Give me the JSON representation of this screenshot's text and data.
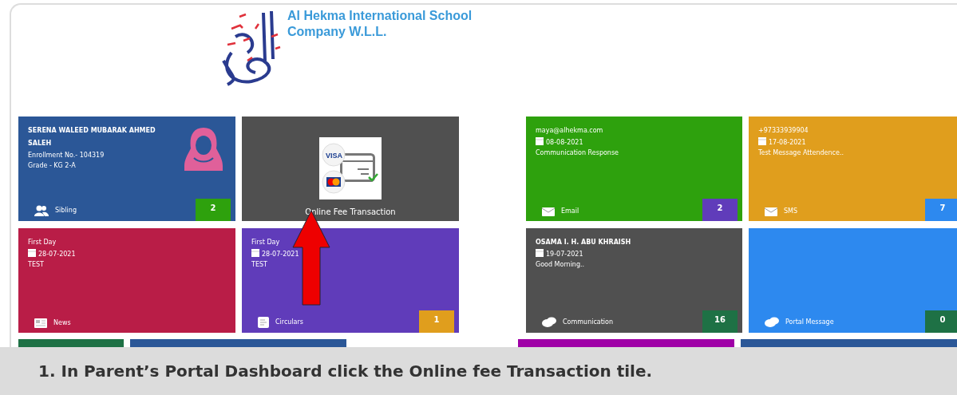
{
  "header": {
    "school_name": "Al Hekma International School",
    "company": "Company W.L.L."
  },
  "tiles": [
    {
      "kind": "student",
      "color": "#2b5797",
      "name": "SERENA WALEED MUBARAK AHMED SALEH",
      "enrollment": "Enrollment No.- 104319",
      "grade": "Grade - KG 2-A",
      "footer": {
        "kind": "people",
        "label": "Sibling"
      },
      "badge": {
        "text": "2",
        "color": "#2ea10d"
      }
    },
    {
      "kind": "feature",
      "color": "#505050",
      "card_brand": "VISA",
      "label": "Online Fee Transaction"
    },
    {
      "kind": "spacer"
    },
    {
      "kind": "message",
      "color": "#2ea10d",
      "title": "maya@alhekma.com",
      "date": "08-08-2021",
      "body": "Communication Response",
      "footer": {
        "kind": "envelope",
        "label": "Email"
      },
      "badge": {
        "text": "2",
        "color": "#603cba"
      }
    },
    {
      "kind": "message",
      "color": "#e09e1d",
      "title": "+97333939904",
      "date": "17-08-2021",
      "body": "Test Message Attendence..",
      "footer": {
        "kind": "envelope",
        "label": "SMS"
      },
      "badge": {
        "text": "7",
        "color": "#2d89ef"
      }
    },
    {
      "kind": "message",
      "color": "#b91d47",
      "title": "First Day",
      "date": "28-07-2021",
      "body": "TEST",
      "footer": {
        "kind": "newspaper",
        "label": "News"
      }
    },
    {
      "kind": "message",
      "color": "#603cba",
      "title": "First Day",
      "date": "28-07-2021",
      "body": "TEST",
      "footer": {
        "kind": "document",
        "label": "Circulars"
      },
      "badge": {
        "text": "1",
        "color": "#e09e1d"
      }
    },
    {
      "kind": "spacer"
    },
    {
      "kind": "message",
      "color": "#505050",
      "title": "OSAMA I. H. ABU KHRAISH",
      "date": "19-07-2021",
      "body": "Good Morning..",
      "footer": {
        "kind": "chat",
        "label": "Communication"
      },
      "badge": {
        "text": "16",
        "color": "#1e7145"
      }
    },
    {
      "kind": "message",
      "color": "#2d89ef",
      "footer": {
        "kind": "chat",
        "label": "Portal Message"
      },
      "badge": {
        "text": "0",
        "color": "#1e7145"
      }
    }
  ],
  "partial_tiles": [
    {
      "color": "#1e7145",
      "kind": "half"
    },
    {
      "color": "#2b5797",
      "kind": "full"
    },
    {
      "color": "#9f00a7",
      "kind": "full"
    },
    {
      "color": "#2b5797",
      "kind": "full"
    }
  ],
  "caption": "1. In Parent’s Portal Dashboard click the Online fee Transaction tile."
}
